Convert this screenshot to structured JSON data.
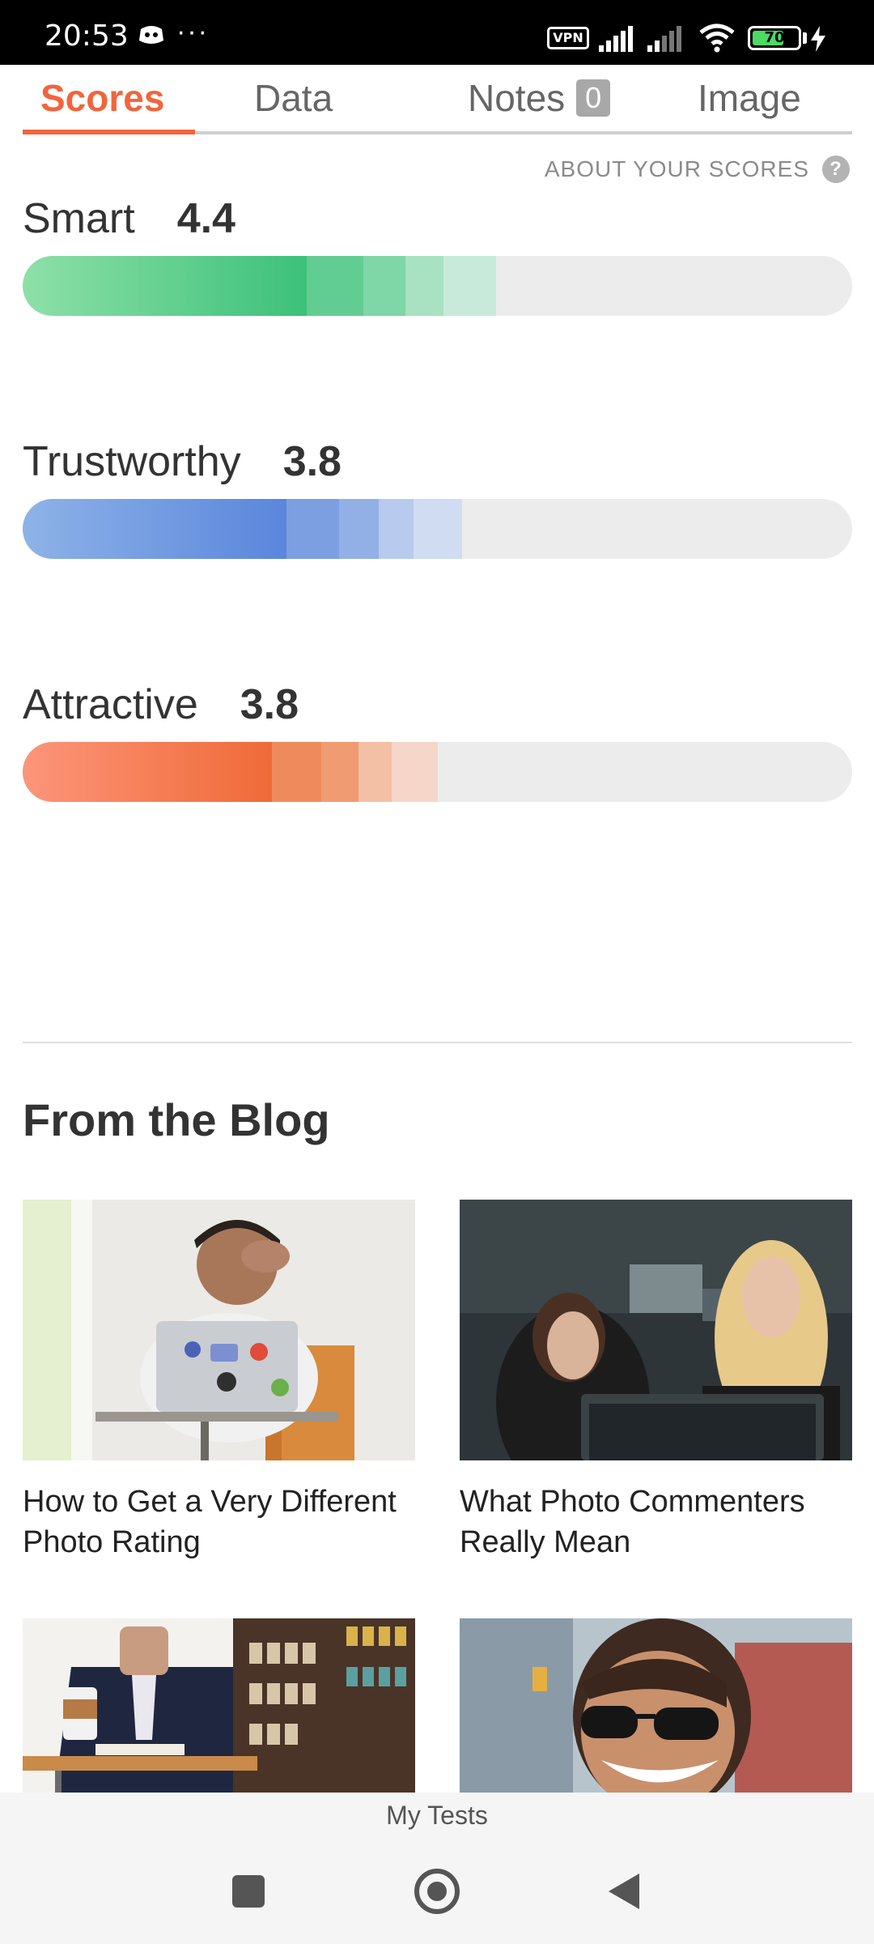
{
  "status_bar": {
    "time": "20:53",
    "more": "···",
    "vpn": "VPN",
    "battery": "70"
  },
  "tabs": [
    {
      "label": "Scores",
      "active": true
    },
    {
      "label": "Data",
      "active": false
    },
    {
      "label": "Notes",
      "badge": "0",
      "active": false
    },
    {
      "label": "Image",
      "active": false
    }
  ],
  "about_link": "ABOUT YOUR SCORES",
  "about_icon": "?",
  "scores": [
    {
      "label": "Smart",
      "value": "4.4",
      "level": 0.57,
      "colors": [
        "#8ee0a8",
        "#3cc17a",
        "#62cd92",
        "#7fd6a6",
        "#a8e2c2",
        "#c8eada"
      ]
    },
    {
      "label": "Trustworthy",
      "value": "3.8",
      "level": 0.53,
      "colors": [
        "#8eb3e8",
        "#5a86dc",
        "#7c9fe2",
        "#93b0e6",
        "#b8caee",
        "#d0dcf2"
      ]
    },
    {
      "label": "Attractive",
      "value": "3.8",
      "level": 0.5,
      "colors": [
        "#fc957a",
        "#f06a38",
        "#ef8a5c",
        "#f09b72",
        "#f3c0a6",
        "#f5d6c8"
      ]
    }
  ],
  "blog": {
    "heading": "From the Blog",
    "posts": [
      {
        "title": "How to Get a Very Different Photo Rating"
      },
      {
        "title": "What Photo Commenters Really Mean"
      },
      {
        "title": ""
      },
      {
        "title": ""
      }
    ]
  },
  "bottom_tab": "My Tests",
  "nav_icons": [
    "recents-icon",
    "home-icon",
    "back-icon"
  ]
}
